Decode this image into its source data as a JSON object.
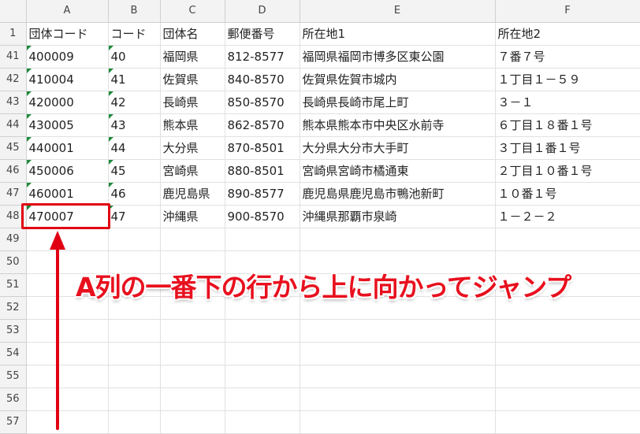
{
  "columns": [
    "A",
    "B",
    "C",
    "D",
    "E",
    "F"
  ],
  "header_row": {
    "row": "1",
    "cells": [
      "団体コード",
      "コード",
      "団体名",
      "郵便番号",
      "所在地1",
      "所在地2"
    ]
  },
  "rows": [
    {
      "row": "41",
      "cells": [
        "400009",
        "40",
        "福岡県",
        "812-8577",
        "福岡県福岡市博多区東公園",
        "７番７号"
      ]
    },
    {
      "row": "42",
      "cells": [
        "410004",
        "41",
        "佐賀県",
        "840-8570",
        "佐賀県佐賀市城内",
        "１丁目１－５９"
      ]
    },
    {
      "row": "43",
      "cells": [
        "420000",
        "42",
        "長崎県",
        "850-8570",
        "長崎県長崎市尾上町",
        "３－１"
      ]
    },
    {
      "row": "44",
      "cells": [
        "430005",
        "43",
        "熊本県",
        "862-8570",
        "熊本県熊本市中央区水前寺",
        "６丁目１８番１号"
      ]
    },
    {
      "row": "45",
      "cells": [
        "440001",
        "44",
        "大分県",
        "870-8501",
        "大分県大分市大手町",
        "３丁目１番１号"
      ]
    },
    {
      "row": "46",
      "cells": [
        "450006",
        "45",
        "宮崎県",
        "880-8501",
        "宮崎県宮崎市橘通東",
        "２丁目１０番１号"
      ]
    },
    {
      "row": "47",
      "cells": [
        "460001",
        "46",
        "鹿児島県",
        "890-8577",
        "鹿児島県鹿児島市鴨池新町",
        "１０番１号"
      ]
    },
    {
      "row": "48",
      "cells": [
        "470007",
        "47",
        "沖縄県",
        "900-8570",
        "沖縄県那覇市泉崎",
        "１－２－２"
      ]
    },
    {
      "row": "49",
      "cells": [
        "",
        "",
        "",
        "",
        "",
        ""
      ]
    },
    {
      "row": "50",
      "cells": [
        "",
        "",
        "",
        "",
        "",
        ""
      ]
    },
    {
      "row": "51",
      "cells": [
        "",
        "",
        "",
        "",
        "",
        ""
      ]
    },
    {
      "row": "52",
      "cells": [
        "",
        "",
        "",
        "",
        "",
        ""
      ]
    },
    {
      "row": "53",
      "cells": [
        "",
        "",
        "",
        "",
        "",
        ""
      ]
    },
    {
      "row": "54",
      "cells": [
        "",
        "",
        "",
        "",
        "",
        ""
      ]
    },
    {
      "row": "55",
      "cells": [
        "",
        "",
        "",
        "",
        "",
        ""
      ]
    },
    {
      "row": "56",
      "cells": [
        "",
        "",
        "",
        "",
        "",
        ""
      ]
    },
    {
      "row": "57",
      "cells": [
        "",
        "",
        "",
        "",
        "",
        ""
      ]
    }
  ],
  "annotation": {
    "text": "A列の一番下の行から上に向かってジャンプ",
    "color": "#e8101e"
  },
  "colors": {
    "header_bg": "#f3f3f3",
    "gridline": "#e1e1e1",
    "text_indicator": "#1e8a3a",
    "highlight": "#e00012"
  }
}
